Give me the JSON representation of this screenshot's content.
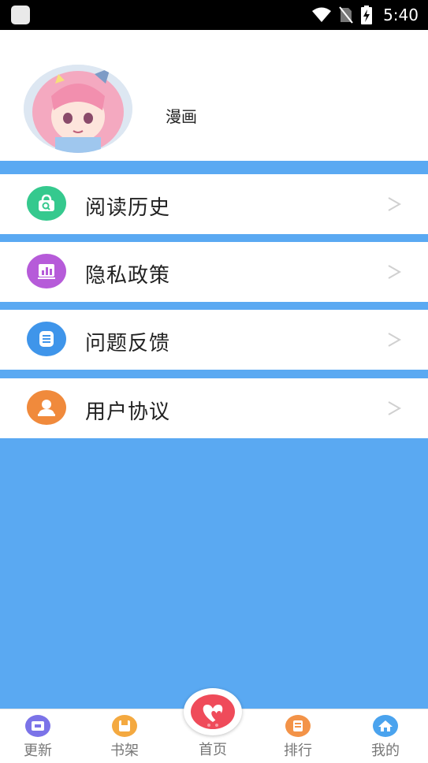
{
  "status_bar": {
    "time": "5:40"
  },
  "profile": {
    "name": "漫画"
  },
  "menu": [
    {
      "label": "阅读历史",
      "icon": "bag-search-icon",
      "color": "#35c98e"
    },
    {
      "label": "隐私政策",
      "icon": "chart-icon",
      "color": "#b65bd9"
    },
    {
      "label": "问题反馈",
      "icon": "list-icon",
      "color": "#3f95ea"
    },
    {
      "label": "用户协议",
      "icon": "person-icon",
      "color": "#f08a3c"
    }
  ],
  "tabs": [
    {
      "label": "更新",
      "icon": "update-icon",
      "color": "#7b73e8"
    },
    {
      "label": "书架",
      "icon": "bookshelf-icon",
      "color": "#f4a940"
    },
    {
      "label": "首页",
      "icon": "home-heart-icon",
      "color": "#ef4b5a"
    },
    {
      "label": "排行",
      "icon": "ranking-icon",
      "color": "#f39348"
    },
    {
      "label": "我的",
      "icon": "mine-house-icon",
      "color": "#4aa3ee"
    }
  ],
  "colors": {
    "background": "#5aa9f2",
    "accent": "#5aa9f2"
  }
}
